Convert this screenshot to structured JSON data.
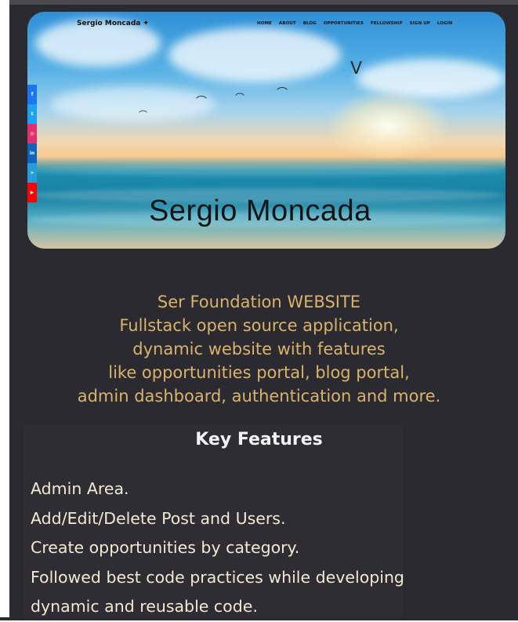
{
  "navbar": {
    "brand": "Sergio Moncada",
    "brand_icon": "twitter-bird-icon",
    "links": [
      "HOME",
      "ABOUT",
      "BLOG",
      "OPPORTUNITIES",
      "FELLOWSHIP",
      "SIGN UP",
      "LOGIN"
    ]
  },
  "social": {
    "icons": [
      {
        "name": "facebook-icon",
        "glyph": "f",
        "color": "#1877f2"
      },
      {
        "name": "twitter-icon",
        "glyph": "t",
        "color": "#1da1f2"
      },
      {
        "name": "instagram-icon",
        "glyph": "◎",
        "color": "#e1306c"
      },
      {
        "name": "linkedin-icon",
        "glyph": "in",
        "color": "#0a66c2"
      },
      {
        "name": "telegram-icon",
        "glyph": "➤",
        "color": "#229ed9"
      },
      {
        "name": "youtube-icon",
        "glyph": "▶",
        "color": "#ff0000"
      }
    ]
  },
  "hero": {
    "title": "Sergio Moncada"
  },
  "intro": {
    "lines": [
      "Ser Foundation WEBSITE",
      "Fullstack open source application,",
      "dynamic website with features",
      "like opportunities portal, blog portal,",
      "admin dashboard, authentication and more."
    ],
    "color": "#d9b36b"
  },
  "features": {
    "heading": "Key Features",
    "items": [
      "Admin Area.",
      "Add/Edit/Delete Post and Users.",
      "Create opportunities by category.",
      "Followed best code practices while developing",
      "dynamic and reusable code."
    ]
  }
}
